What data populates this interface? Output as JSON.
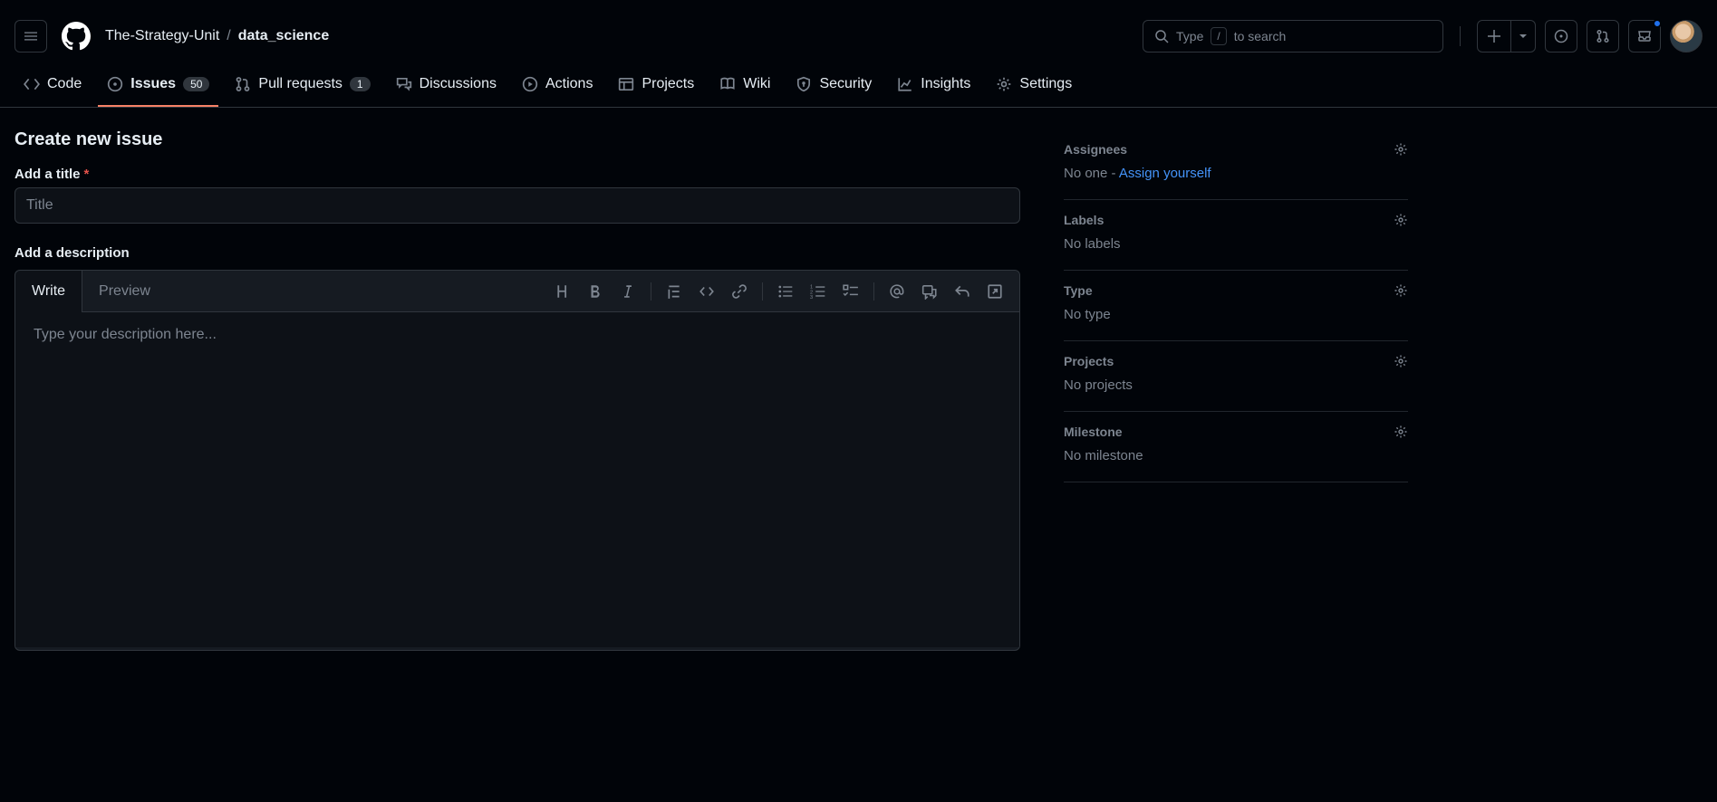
{
  "breadcrumb": {
    "org": "The-Strategy-Unit",
    "sep": "/",
    "repo": "data_science"
  },
  "search": {
    "prefix": "Type",
    "key": "/",
    "suffix": "to search"
  },
  "nav": {
    "code": "Code",
    "issues": "Issues",
    "issues_count": "50",
    "pulls": "Pull requests",
    "pulls_count": "1",
    "discussions": "Discussions",
    "actions": "Actions",
    "projects": "Projects",
    "wiki": "Wiki",
    "security": "Security",
    "insights": "Insights",
    "settings": "Settings"
  },
  "page": {
    "title": "Create new issue",
    "title_label": "Add a title",
    "title_placeholder": "Title",
    "desc_label": "Add a description",
    "tab_write": "Write",
    "tab_preview": "Preview",
    "desc_placeholder": "Type your description here..."
  },
  "sidebar": {
    "assignees": {
      "label": "Assignees",
      "text": "No one - ",
      "link": "Assign yourself"
    },
    "labels": {
      "label": "Labels",
      "text": "No labels"
    },
    "type": {
      "label": "Type",
      "text": "No type"
    },
    "projects": {
      "label": "Projects",
      "text": "No projects"
    },
    "milestone": {
      "label": "Milestone",
      "text": "No milestone"
    }
  }
}
